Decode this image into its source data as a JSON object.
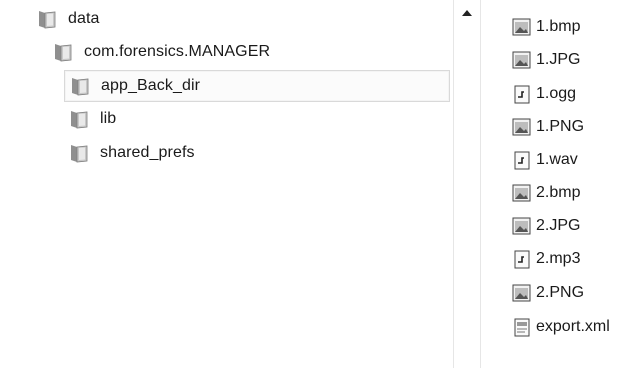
{
  "tree": {
    "items": [
      {
        "label": "data",
        "icon": "folder-icon"
      },
      {
        "label": "com.forensics.MANAGER",
        "icon": "folder-icon"
      },
      {
        "label": "app_Back_dir",
        "icon": "folder-icon",
        "selected": true
      },
      {
        "label": "lib",
        "icon": "folder-icon"
      },
      {
        "label": "shared_prefs",
        "icon": "folder-icon"
      }
    ]
  },
  "files": {
    "items": [
      {
        "label": "1.bmp",
        "icon": "image-file-icon"
      },
      {
        "label": "1.JPG",
        "icon": "image-file-icon"
      },
      {
        "label": "1.ogg",
        "icon": "audio-file-icon"
      },
      {
        "label": "1.PNG",
        "icon": "image-file-icon"
      },
      {
        "label": "1.wav",
        "icon": "audio-file-icon"
      },
      {
        "label": "2.bmp",
        "icon": "image-file-icon"
      },
      {
        "label": "2.JPG",
        "icon": "image-file-icon"
      },
      {
        "label": "2.mp3",
        "icon": "audio-file-icon"
      },
      {
        "label": "2.PNG",
        "icon": "image-file-icon"
      },
      {
        "label": "export.xml",
        "icon": "xml-file-icon"
      }
    ]
  }
}
